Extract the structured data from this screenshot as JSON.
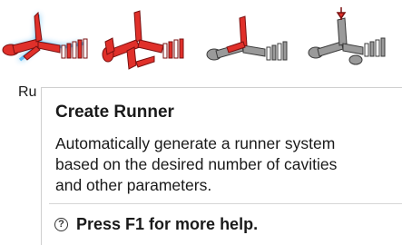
{
  "ribbon": {
    "tools": [
      {
        "icon": "runner-glow-icon",
        "state": "highlighted",
        "color": "#e0302a"
      },
      {
        "icon": "runner-multi-cavity-icon",
        "state": "normal",
        "color": "#e0302a"
      },
      {
        "icon": "runner-red-gray-icon",
        "state": "normal",
        "color": "#e0302a"
      },
      {
        "icon": "runner-gray-pin-icon",
        "state": "normal",
        "color": "#8a8a8a"
      }
    ],
    "label": "Ru"
  },
  "tooltip": {
    "title": "Create Runner",
    "body_lines": [
      "Automatically generate a runner system",
      "based on the desired number of cavities",
      "and other parameters."
    ],
    "help_icon": "question-circle-icon",
    "help_text": "Press F1 for more help."
  },
  "colors": {
    "accent_red": "#e0302a",
    "glow": "#4fb4f0",
    "gray": "#8a8a8a"
  }
}
